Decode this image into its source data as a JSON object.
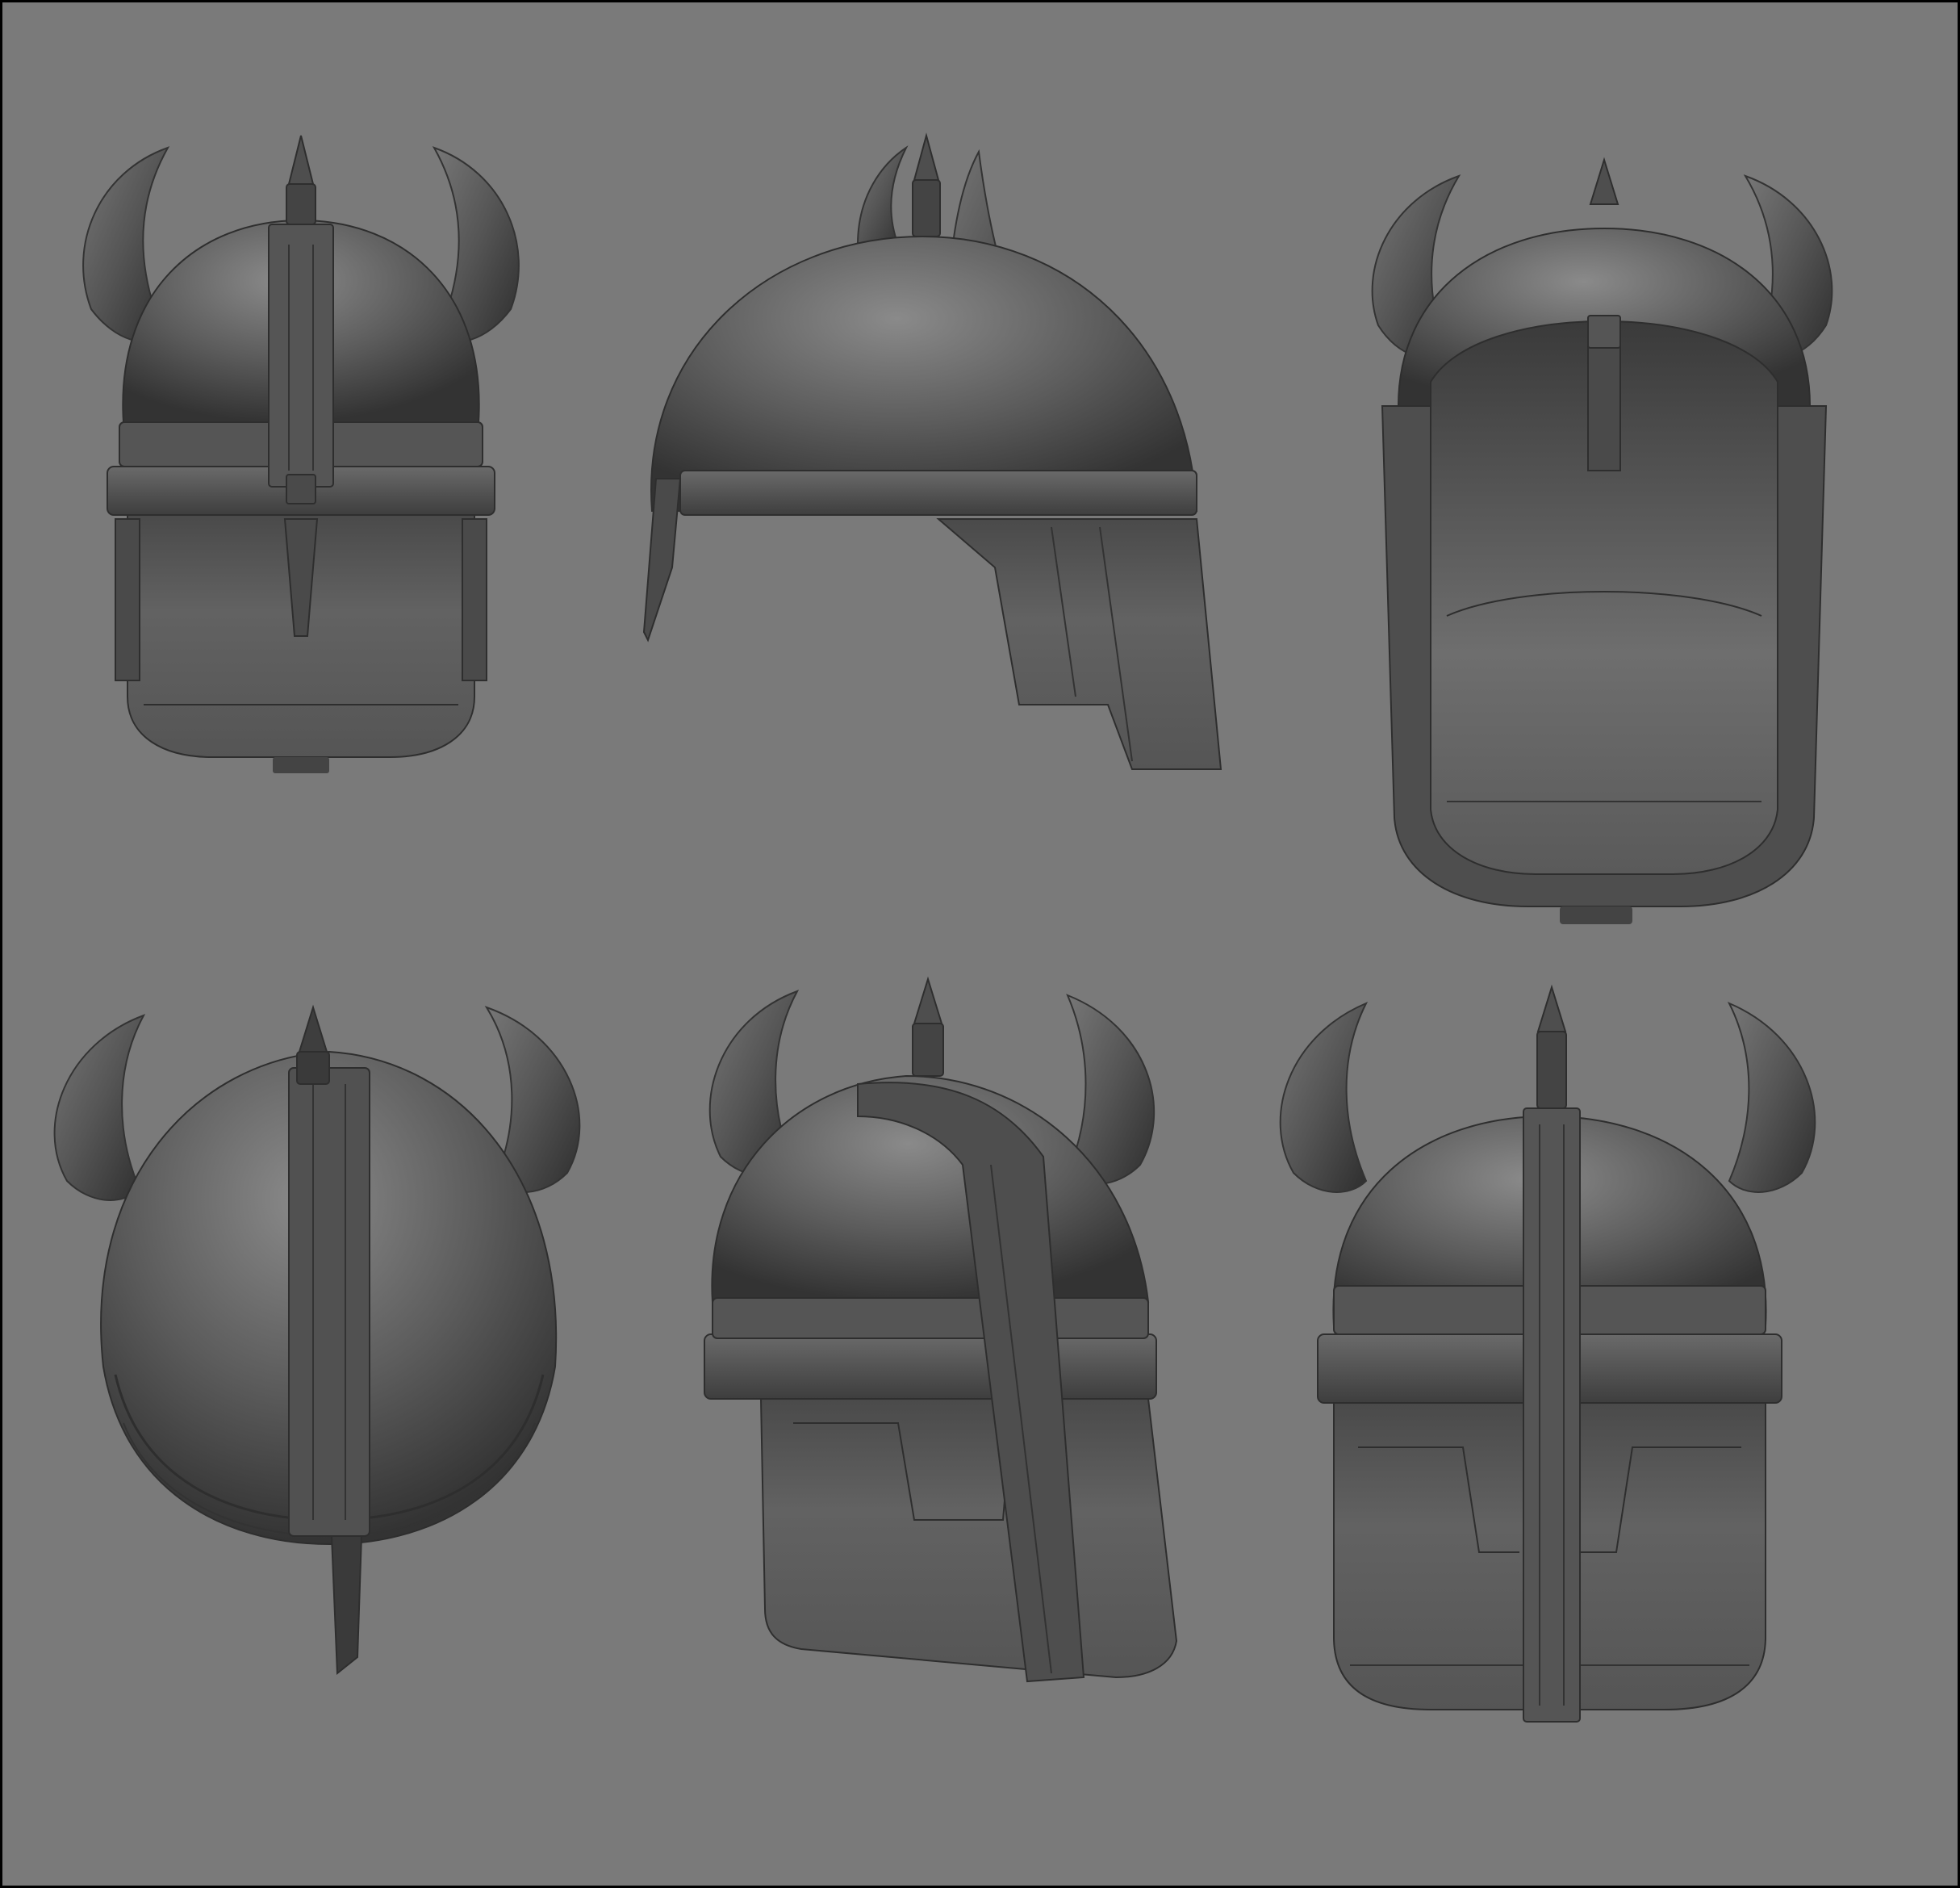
{
  "canvas": {
    "background": "#7a7a7a",
    "border": "#000000"
  },
  "model": {
    "base_color": "#5c5c5c",
    "dark_color": "#3c3c3c",
    "light_color": "#8a8a8a",
    "line_color": "#2e2e2e"
  },
  "views": [
    {
      "id": "front",
      "feature": "horned-helmet"
    },
    {
      "id": "side",
      "feature": "horned-helmet"
    },
    {
      "id": "inside-front",
      "feature": "horned-helmet"
    },
    {
      "id": "back-top",
      "feature": "horned-helmet"
    },
    {
      "id": "three-quarter",
      "feature": "horned-helmet"
    },
    {
      "id": "front-low",
      "feature": "horned-helmet"
    }
  ]
}
